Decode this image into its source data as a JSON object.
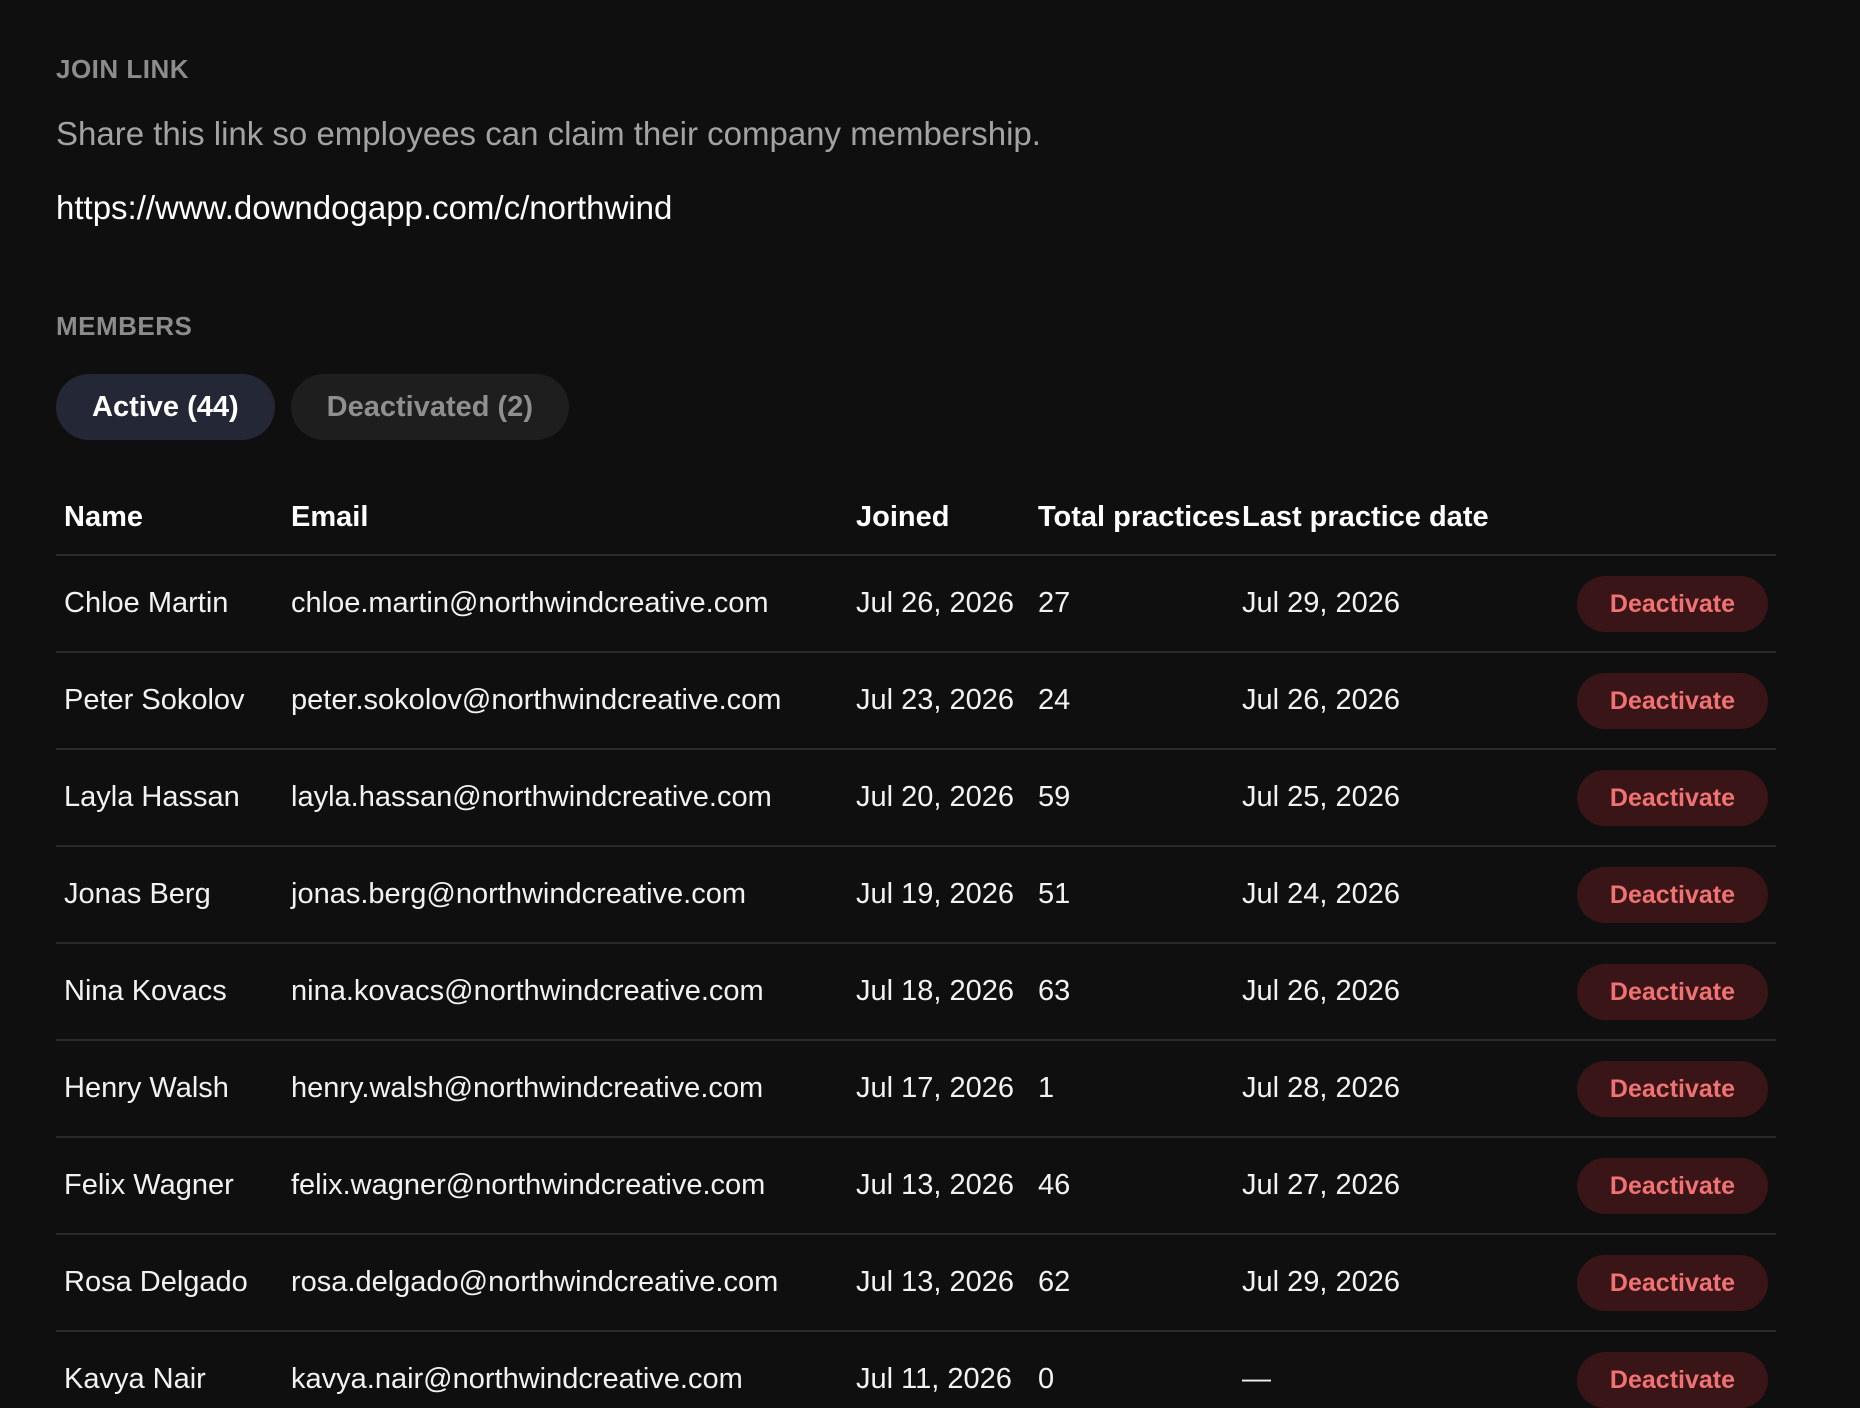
{
  "join_link": {
    "label": "JOIN LINK",
    "description": "Share this link so employees can claim their company membership.",
    "url": "https://www.downdogapp.com/c/northwind"
  },
  "members": {
    "label": "MEMBERS",
    "tabs": [
      {
        "label": "Active (44)",
        "selected": true
      },
      {
        "label": "Deactivated (2)",
        "selected": false
      }
    ],
    "columns": [
      "Name",
      "Email",
      "Joined",
      "Total practices",
      "Last practice date",
      ""
    ],
    "action_label": "Deactivate",
    "rows": [
      {
        "name": "Chloe Martin",
        "email": "chloe.martin@northwindcreative.com",
        "joined": "Jul 26, 2026",
        "total": "27",
        "last": "Jul 29, 2026"
      },
      {
        "name": "Peter Sokolov",
        "email": "peter.sokolov@northwindcreative.com",
        "joined": "Jul 23, 2026",
        "total": "24",
        "last": "Jul 26, 2026"
      },
      {
        "name": "Layla Hassan",
        "email": "layla.hassan@northwindcreative.com",
        "joined": "Jul 20, 2026",
        "total": "59",
        "last": "Jul 25, 2026"
      },
      {
        "name": "Jonas Berg",
        "email": "jonas.berg@northwindcreative.com",
        "joined": "Jul 19, 2026",
        "total": "51",
        "last": "Jul 24, 2026"
      },
      {
        "name": "Nina Kovacs",
        "email": "nina.kovacs@northwindcreative.com",
        "joined": "Jul 18, 2026",
        "total": "63",
        "last": "Jul 26, 2026"
      },
      {
        "name": "Henry Walsh",
        "email": "henry.walsh@northwindcreative.com",
        "joined": "Jul 17, 2026",
        "total": "1",
        "last": "Jul 28, 2026"
      },
      {
        "name": "Felix Wagner",
        "email": "felix.wagner@northwindcreative.com",
        "joined": "Jul 13, 2026",
        "total": "46",
        "last": "Jul 27, 2026"
      },
      {
        "name": "Rosa Delgado",
        "email": "rosa.delgado@northwindcreative.com",
        "joined": "Jul 13, 2026",
        "total": "62",
        "last": "Jul 29, 2026"
      },
      {
        "name": "Kavya Nair",
        "email": "kavya.nair@northwindcreative.com",
        "joined": "Jul 11, 2026",
        "total": "0",
        "last": "—"
      }
    ]
  },
  "colors": {
    "background": "#0f0f0f",
    "tab_active_bg": "#232736",
    "deactivate_bg": "#3a1517",
    "deactivate_text": "#f07272"
  }
}
